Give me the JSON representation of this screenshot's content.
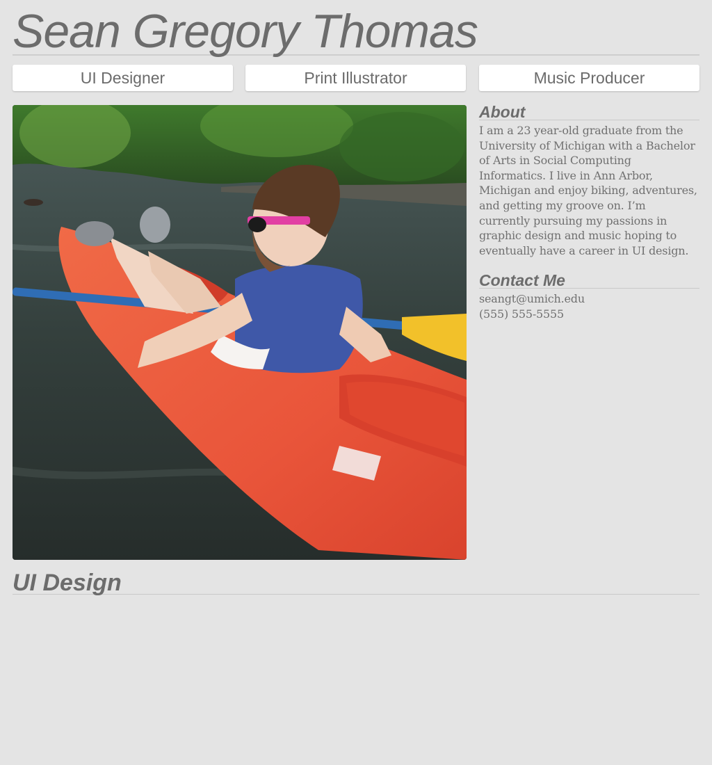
{
  "site_title": "Sean Gregory Thomas",
  "nav": {
    "items": [
      "UI Designer",
      "Print Illustrator",
      "Music Producer"
    ]
  },
  "about": {
    "heading": "About",
    "text": "I am a 23 year-old graduate from the University of Michigan with a Bachelor of Arts in Social Computing Informatics. I live in Ann Arbor, Michigan and enjoy biking, adventures, and getting my groove on. I’m currently pursuing my passions in graphic design and music hoping to eventually have a career in UI design."
  },
  "contact": {
    "heading": "Contact Me",
    "email": "seangt@umich.edu",
    "phone": "(555) 555-5555"
  },
  "section": {
    "heading": "UI Design"
  },
  "colors": {
    "background": "#e4e4e4",
    "text": "#6c6c6c",
    "button": "#ffffff",
    "kayak": "#e8553a",
    "vest": "#3f58a8"
  }
}
